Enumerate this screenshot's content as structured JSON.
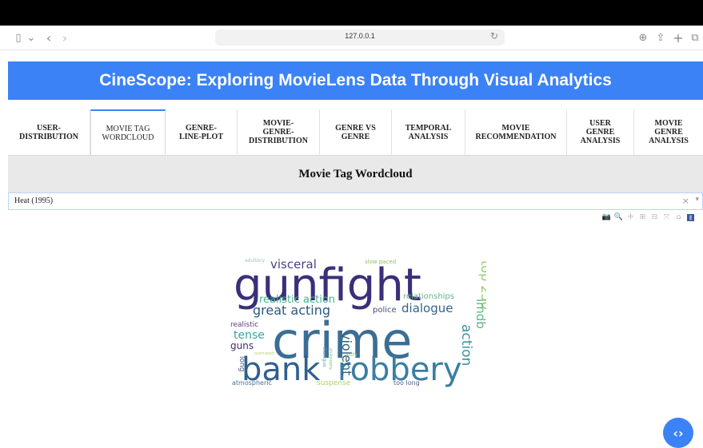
{
  "browser": {
    "url": "127.0.0.1",
    "icons": {
      "sidebar": "▯",
      "dropdown": "⌄",
      "back": "‹",
      "forward": "›",
      "reload": "↻",
      "download": "⊕",
      "share": "⇪",
      "new_tab": "+",
      "tabs": "⧉"
    }
  },
  "header": {
    "title": "CineScope: Exploring MovieLens Data Through Visual Analytics"
  },
  "tabs": [
    {
      "label": "USER-\nDISTRIBUTION"
    },
    {
      "label": "MOVIE TAG\nWORDCLOUD"
    },
    {
      "label": "GENRE-\nLINE-PLOT"
    },
    {
      "label": "MOVIE-\nGENRE-\nDISTRIBUTION"
    },
    {
      "label": "GENRE VS\nGENRE"
    },
    {
      "label": "TEMPORAL\nANALYSIS"
    },
    {
      "label": "MOVIE\nRECOMMENDATION"
    },
    {
      "label": "USER\nGENRE\nANALYSIS"
    },
    {
      "label": "MOVIE\nGENRE\nANALYSIS"
    }
  ],
  "active_tab": "MOVIE TAG WORDCLOUD",
  "panel": {
    "title": "Movie Tag Wordcloud"
  },
  "dropdown": {
    "value": "Heat (1995)",
    "clear": "×",
    "caret": "▾"
  },
  "modebar": {
    "camera": "📷",
    "zoom": "🔍",
    "pan": "✛",
    "zoom_in": "⊞",
    "zoom_out": "⊟",
    "autoscale": "⤧",
    "reset": "⌂",
    "logo": "ǁ"
  },
  "wordcloud": {
    "words": [
      {
        "text": "gunfight",
        "color": "#3b2f78"
      },
      {
        "text": "crime",
        "color": "#3b6e94"
      },
      {
        "text": "bank",
        "color": "#2f5f8f"
      },
      {
        "text": "robbery",
        "color": "#3a7ea3"
      },
      {
        "text": "great acting",
        "color": "#2a587e"
      },
      {
        "text": "visceral",
        "color": "#4a3f86"
      },
      {
        "text": "realistic action",
        "color": "#45b38a"
      },
      {
        "text": "dialogue",
        "color": "#33658a"
      },
      {
        "text": "top 250",
        "color": "#94cf6a"
      },
      {
        "text": "imdb",
        "color": "#5cb882"
      },
      {
        "text": "action",
        "color": "#3b8fa1"
      },
      {
        "text": "violent",
        "color": "#31627e"
      },
      {
        "text": "tense",
        "color": "#3aa4a0"
      },
      {
        "text": "guns",
        "color": "#442c6d"
      },
      {
        "text": "realistic",
        "color": "#5b3e83"
      },
      {
        "text": "relationships",
        "color": "#68b38d"
      },
      {
        "text": "police",
        "color": "#3d4f80"
      },
      {
        "text": "long",
        "color": "#4b5a88"
      },
      {
        "text": "atmospheric",
        "color": "#4d7091"
      },
      {
        "text": "suspense",
        "color": "#a8d36a"
      },
      {
        "text": "too long",
        "color": "#4f5e8d"
      },
      {
        "text": "slow paced",
        "color": "#8bc25a"
      },
      {
        "text": "adultery",
        "color": "#9ec7a0"
      },
      {
        "text": "overrated",
        "color": "#b7d66a"
      },
      {
        "text": "witty",
        "color": "#9bc57a"
      },
      {
        "text": "dialogue",
        "color": "#5aa3a8"
      },
      {
        "text": "philosophy",
        "color": "#7ac07a"
      }
    ]
  }
}
